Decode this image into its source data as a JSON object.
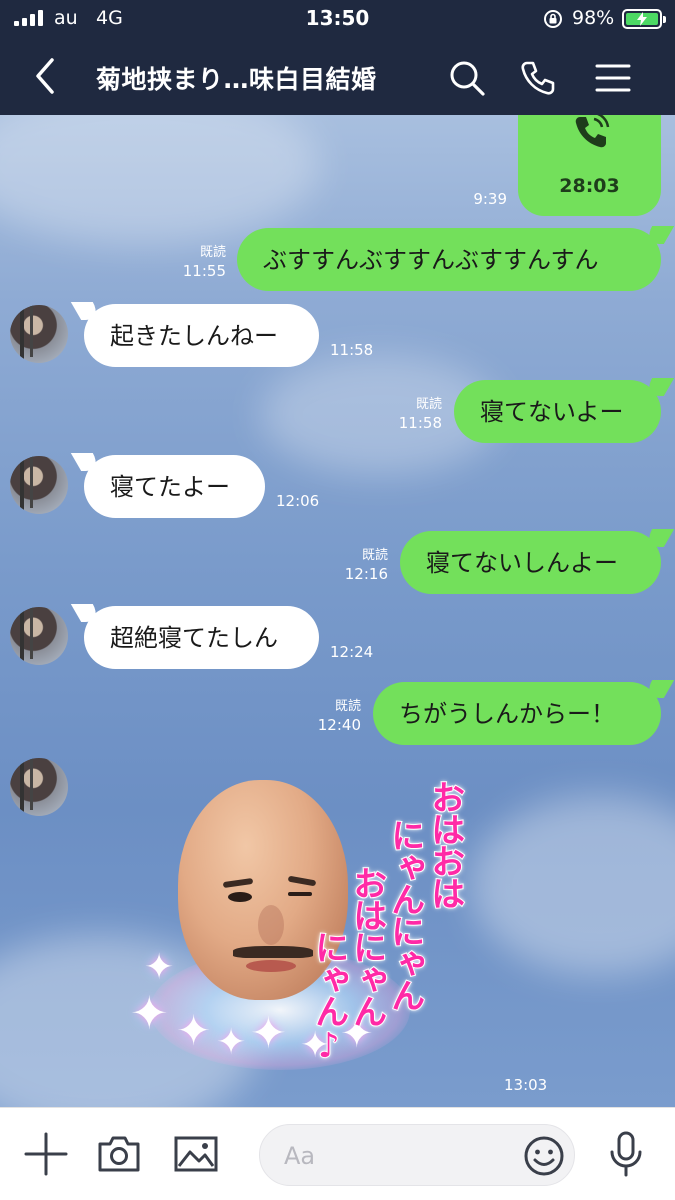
{
  "status_bar": {
    "carrier": "au",
    "network": "4G",
    "time": "13:50",
    "battery": "98%"
  },
  "header": {
    "title": "菊地挟まり…味白目結婚"
  },
  "call": {
    "time": "9:39",
    "duration": "28:03"
  },
  "messages": [
    {
      "dir": "out",
      "text": "ぶすすんぶすすんぶすすんすん",
      "read": "既読",
      "time": "11:55"
    },
    {
      "dir": "in",
      "text": "起きたしんねー",
      "time": "11:58"
    },
    {
      "dir": "out",
      "text": "寝てないよー",
      "read": "既読",
      "time": "11:58"
    },
    {
      "dir": "in",
      "text": "寝てたよー",
      "time": "12:06"
    },
    {
      "dir": "out",
      "text": "寝てないしんよー",
      "read": "既読",
      "time": "12:16"
    },
    {
      "dir": "in",
      "text": "超絶寝てたしん",
      "time": "12:24"
    },
    {
      "dir": "out",
      "text": "ちがうしんからー！",
      "read": "既読",
      "time": "12:40"
    }
  ],
  "sticker": {
    "lines": [
      "おはおは",
      "にゃんにゃん",
      "おはにゃん",
      "にゃん♪"
    ],
    "time": "13:03"
  },
  "input": {
    "placeholder": "Aa"
  },
  "colors": {
    "header_bg": "#1f2940",
    "bubble_out": "#73e05b",
    "bubble_in": "#ffffff",
    "sticker_text": "#ff2aa6"
  }
}
